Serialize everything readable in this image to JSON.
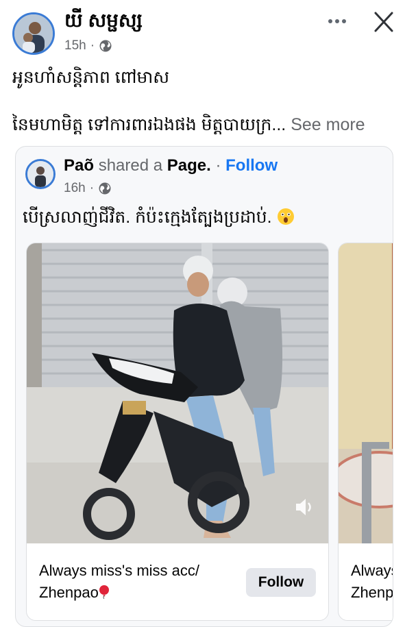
{
  "post": {
    "author": "យី សម្ផស្ស",
    "time": "15h",
    "audience_icon": "globe-icon",
    "line1": "អូនហាំសន្តិភាព ពៅមាស",
    "line2": "នៃមហាមិត្ត ទៅការពារឯងផង មិត្តបាយក្រ...",
    "see_more": "See more"
  },
  "shared": {
    "name": "Paõ",
    "verb": "shared a",
    "page_word": "Page.",
    "separator": "·",
    "follow": "Follow",
    "time": "16h",
    "text": "បើស្រលាញ់ជីវិត. កំប៉ះក្មេងត្បែងប្រដាប់."
  },
  "cards": [
    {
      "caption_line1": "Always miss's miss acc/",
      "caption_line2": "Zhenpao",
      "follow_label": "Follow"
    },
    {
      "caption_line1": "Always",
      "caption_line2": "Zhenpa"
    }
  ],
  "colors": {
    "accent": "#1877f2",
    "muted": "#65676b",
    "button_bg": "#e4e6eb"
  }
}
